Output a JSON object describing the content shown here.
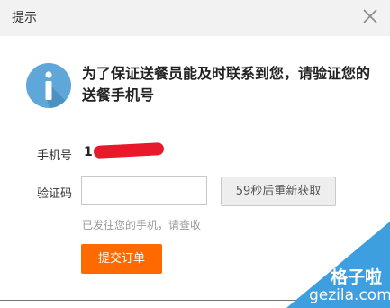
{
  "dialog": {
    "title": "提示",
    "message": "为了保证送餐员能及时联系到您，请验证您的送餐手机号"
  },
  "form": {
    "phone_label": "手机号",
    "phone_value": "1",
    "code_label": "验证码",
    "code_value": "",
    "resend_label": "59秒后重新获取",
    "hint": "已发往您的手机，请查收",
    "submit_label": "提交订单"
  },
  "watermark": {
    "brand": "格子啦",
    "domain": "gezila.com"
  },
  "icons": {
    "close": "close-icon",
    "info": "info-icon"
  },
  "colors": {
    "accent": "#ff6a00",
    "info_icon": "#5ea7d8",
    "watermark": "#3d9fe0"
  }
}
